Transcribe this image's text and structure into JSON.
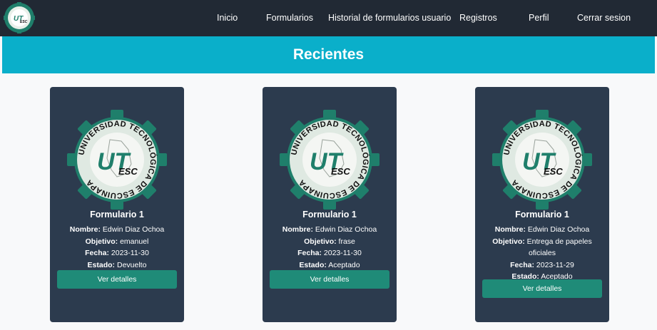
{
  "nav": {
    "items": [
      {
        "label": "Inicio"
      },
      {
        "label": "Formularios"
      },
      {
        "label": "Historial de formularios usuario"
      },
      {
        "label": "Registros"
      },
      {
        "label": "Perfil"
      },
      {
        "label": "Cerrar sesion"
      }
    ]
  },
  "logo": {
    "brand_text": "UT",
    "brand_subtext": "ESC",
    "ring_text": "UNIVERSIDAD TECNOLÓGICA DE ESCUINAPA",
    "colors": {
      "gear": "#1f7f6b",
      "ring_text": "#111111",
      "ut": "#1f7f6b",
      "esc": "#111111"
    }
  },
  "hero": {
    "title": "Recientes"
  },
  "labels": {
    "nombre": "Nombre:",
    "objetivo": "Objetivo:",
    "fecha": "Fecha:",
    "estado": "Estado:",
    "details_button": "Ver detalles"
  },
  "cards": [
    {
      "title": "Formulario 1",
      "nombre": "Edwin Diaz Ochoa",
      "objetivo": "emanuel",
      "fecha": "2023-11-30",
      "estado": "Devuelto"
    },
    {
      "title": "Formulario 1",
      "nombre": "Edwin Diaz Ochoa",
      "objetivo": "frase",
      "fecha": "2023-11-30",
      "estado": "Aceptado"
    },
    {
      "title": "Formulario 1",
      "nombre": "Edwin Diaz Ochoa",
      "objetivo": "Entrega de papeles oficiales",
      "fecha": "2023-11-29",
      "estado": "Aceptado"
    }
  ],
  "colors": {
    "navbar": "#212934",
    "hero": "#0aafca",
    "card": "#2c3b4e",
    "button": "#1f8b78",
    "page": "#f8f9fa"
  }
}
